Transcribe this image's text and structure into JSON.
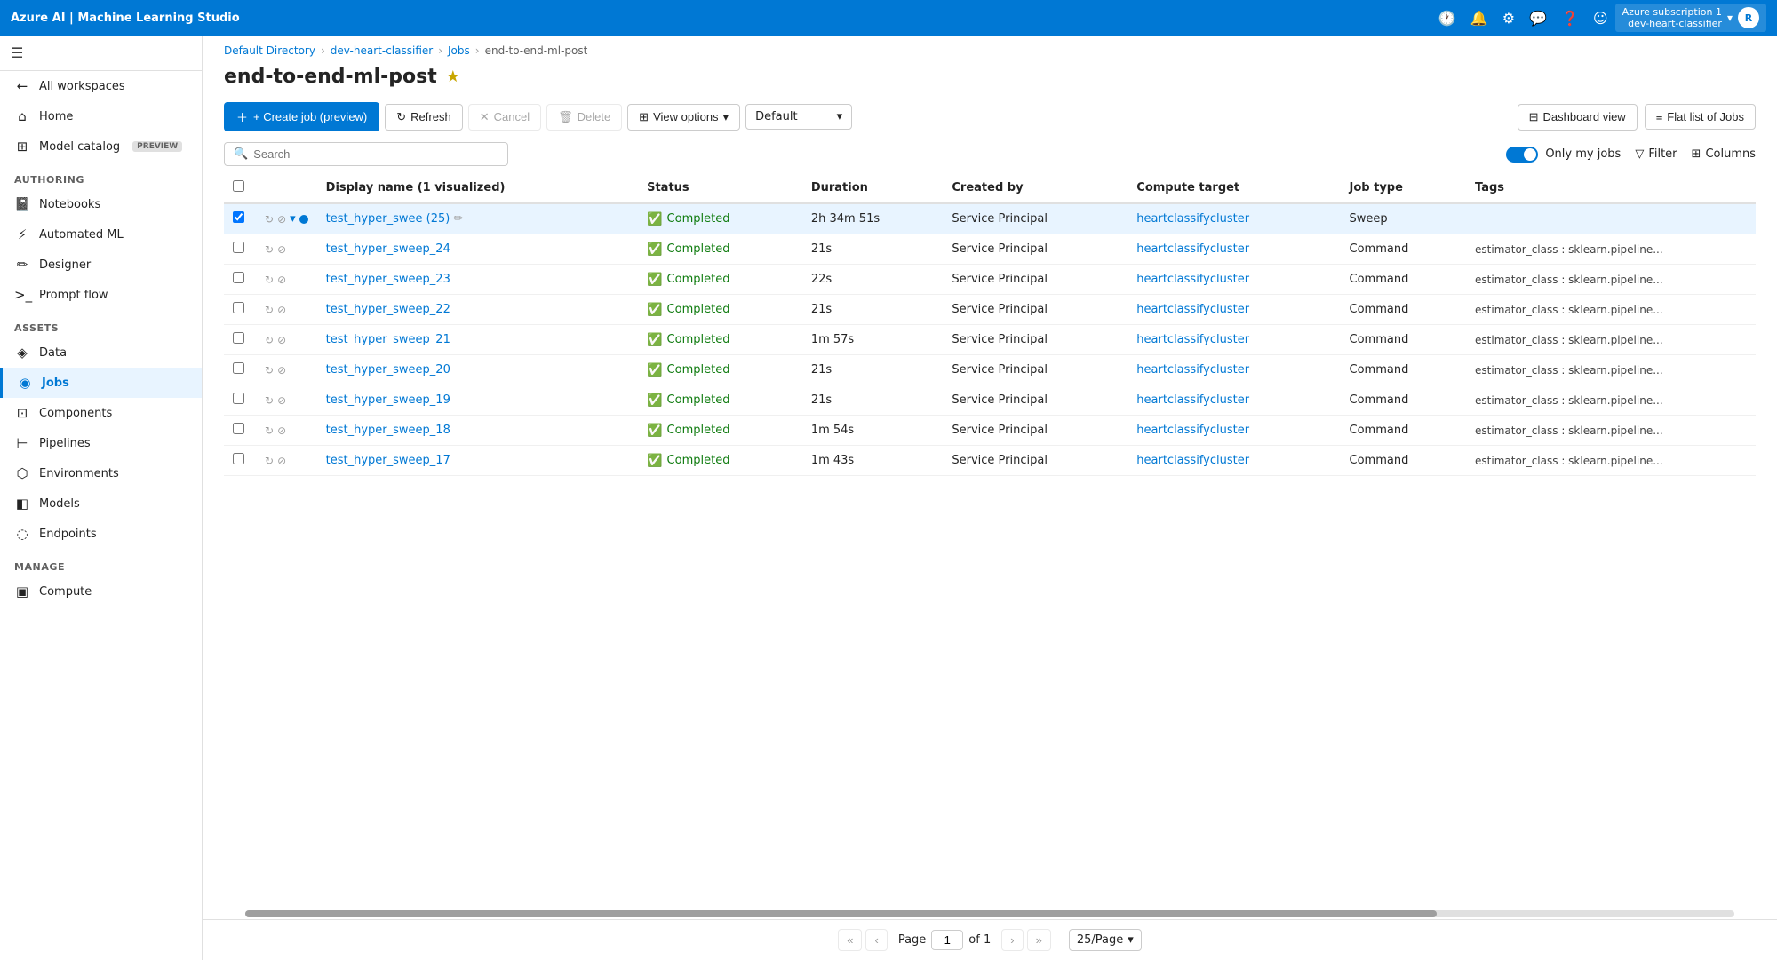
{
  "topbar": {
    "title": "Azure AI | Machine Learning Studio",
    "user_subscription": "Azure subscription 1",
    "user_workspace": "dev-heart-classifier",
    "user_initial": "R"
  },
  "breadcrumb": {
    "items": [
      {
        "label": "Default Directory",
        "link": true
      },
      {
        "label": "dev-heart-classifier",
        "link": true
      },
      {
        "label": "Jobs",
        "link": true
      },
      {
        "label": "end-to-end-ml-post",
        "link": false
      }
    ]
  },
  "page": {
    "title": "end-to-end-ml-post"
  },
  "toolbar": {
    "create_job_label": "+ Create job (preview)",
    "refresh_label": "Refresh",
    "cancel_label": "Cancel",
    "delete_label": "Delete",
    "view_options_label": "View options",
    "default_label": "Default",
    "dashboard_view_label": "Dashboard view",
    "flat_list_label": "Flat list of Jobs"
  },
  "search": {
    "placeholder": "Search"
  },
  "filters": {
    "only_my_jobs_label": "Only my jobs",
    "filter_label": "Filter",
    "columns_label": "Columns"
  },
  "table": {
    "columns": [
      "Display name (1 visualized)",
      "Status",
      "Duration",
      "Created by",
      "Compute target",
      "Job type",
      "Tags"
    ],
    "rows": [
      {
        "id": 1,
        "selected": true,
        "name": "test_hyper_swee (25)",
        "has_expand": true,
        "has_dot": true,
        "status": "Completed",
        "duration": "2h 34m 51s",
        "created_by": "Service Principal",
        "compute_target": "heartclassifycluster",
        "job_type": "Sweep",
        "tags": ""
      },
      {
        "id": 2,
        "selected": false,
        "name": "test_hyper_sweep_24",
        "has_expand": false,
        "has_dot": false,
        "status": "Completed",
        "duration": "21s",
        "created_by": "Service Principal",
        "compute_target": "heartclassifycluster",
        "job_type": "Command",
        "tags": "estimator_class : sklearn.pipeline..."
      },
      {
        "id": 3,
        "selected": false,
        "name": "test_hyper_sweep_23",
        "has_expand": false,
        "has_dot": false,
        "status": "Completed",
        "duration": "22s",
        "created_by": "Service Principal",
        "compute_target": "heartclassifycluster",
        "job_type": "Command",
        "tags": "estimator_class : sklearn.pipeline..."
      },
      {
        "id": 4,
        "selected": false,
        "name": "test_hyper_sweep_22",
        "has_expand": false,
        "has_dot": false,
        "status": "Completed",
        "duration": "21s",
        "created_by": "Service Principal",
        "compute_target": "heartclassifycluster",
        "job_type": "Command",
        "tags": "estimator_class : sklearn.pipeline..."
      },
      {
        "id": 5,
        "selected": false,
        "name": "test_hyper_sweep_21",
        "has_expand": false,
        "has_dot": false,
        "status": "Completed",
        "duration": "1m 57s",
        "created_by": "Service Principal",
        "compute_target": "heartclassifycluster",
        "job_type": "Command",
        "tags": "estimator_class : sklearn.pipeline..."
      },
      {
        "id": 6,
        "selected": false,
        "name": "test_hyper_sweep_20",
        "has_expand": false,
        "has_dot": false,
        "status": "Completed",
        "duration": "21s",
        "created_by": "Service Principal",
        "compute_target": "heartclassifycluster",
        "job_type": "Command",
        "tags": "estimator_class : sklearn.pipeline..."
      },
      {
        "id": 7,
        "selected": false,
        "name": "test_hyper_sweep_19",
        "has_expand": false,
        "has_dot": false,
        "status": "Completed",
        "duration": "21s",
        "created_by": "Service Principal",
        "compute_target": "heartclassifycluster",
        "job_type": "Command",
        "tags": "estimator_class : sklearn.pipeline..."
      },
      {
        "id": 8,
        "selected": false,
        "name": "test_hyper_sweep_18",
        "has_expand": false,
        "has_dot": false,
        "status": "Completed",
        "duration": "1m 54s",
        "created_by": "Service Principal",
        "compute_target": "heartclassifycluster",
        "job_type": "Command",
        "tags": "estimator_class : sklearn.pipeline..."
      },
      {
        "id": 9,
        "selected": false,
        "name": "test_hyper_sweep_17",
        "has_expand": false,
        "has_dot": false,
        "status": "Completed",
        "duration": "1m 43s",
        "created_by": "Service Principal",
        "compute_target": "heartclassifycluster",
        "job_type": "Command",
        "tags": "estimator_class : sklearn.pipeline..."
      }
    ]
  },
  "pagination": {
    "page_label": "Page",
    "current_page": "1",
    "of_label": "of 1",
    "per_page": "25/Page"
  },
  "sidebar": {
    "all_workspaces": "All workspaces",
    "sections": [
      {
        "label": "",
        "items": [
          {
            "id": "home",
            "icon": "⌂",
            "label": "Home"
          },
          {
            "id": "model-catalog",
            "icon": "⊞",
            "label": "Model catalog",
            "badge": "PREVIEW"
          }
        ]
      },
      {
        "label": "Authoring",
        "items": [
          {
            "id": "notebooks",
            "icon": "📓",
            "label": "Notebooks"
          },
          {
            "id": "automated-ml",
            "icon": "⚡",
            "label": "Automated ML"
          },
          {
            "id": "designer",
            "icon": "✏",
            "label": "Designer"
          },
          {
            "id": "prompt-flow",
            "icon": ">_",
            "label": "Prompt flow"
          }
        ]
      },
      {
        "label": "Assets",
        "items": [
          {
            "id": "data",
            "icon": "◈",
            "label": "Data"
          },
          {
            "id": "jobs",
            "icon": "◉",
            "label": "Jobs",
            "active": true
          },
          {
            "id": "components",
            "icon": "⊡",
            "label": "Components"
          },
          {
            "id": "pipelines",
            "icon": "⊢",
            "label": "Pipelines"
          },
          {
            "id": "environments",
            "icon": "⬡",
            "label": "Environments"
          },
          {
            "id": "models",
            "icon": "◧",
            "label": "Models"
          },
          {
            "id": "endpoints",
            "icon": "◌",
            "label": "Endpoints"
          }
        ]
      },
      {
        "label": "Manage",
        "items": [
          {
            "id": "compute",
            "icon": "▣",
            "label": "Compute"
          }
        ]
      }
    ]
  }
}
